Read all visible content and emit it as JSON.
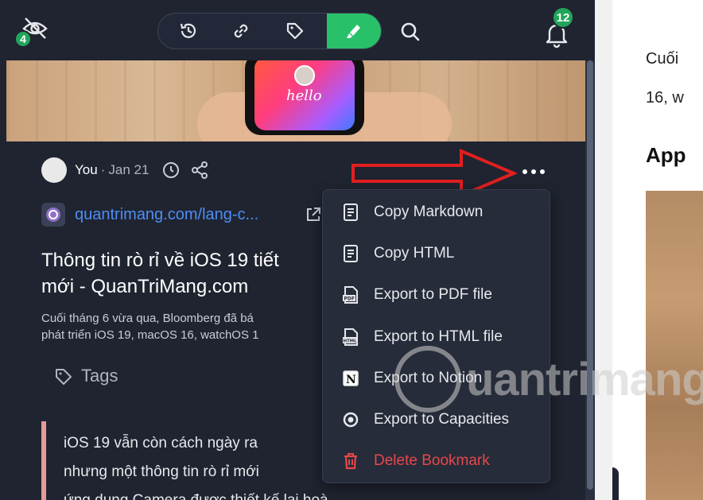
{
  "toolbar": {
    "hidden_count": "4",
    "notifications_count": "12",
    "icons": [
      "eye-off-icon",
      "history-icon",
      "link-icon",
      "tag-icon",
      "highlighter-icon",
      "search-icon",
      "bell-icon"
    ],
    "active_color": "#29c06a"
  },
  "hero": {
    "image_text": "hello"
  },
  "bookmark": {
    "author": "You",
    "separator": "·",
    "date": "Jan 21",
    "url": "quantrimang.com/lang-c...",
    "title_line1": "Thông tin rò rỉ về iOS 19 tiết",
    "title_line2": "mới - QuanTriMang.com",
    "desc_line1": "Cuối tháng 6 vừa qua, Bloomberg đã bá",
    "desc_line2": "phát triển iOS 19, macOS 16, watchOS 1",
    "tags_label": "Tags",
    "quote_line1": "iOS 19 vẫn còn cách ngày ra",
    "quote_line2": "nhưng một thông tin rò rỉ mới",
    "quote_line3": "ứng dụng Camera được thiết kế lại hoàn toàn",
    "quote_border_color": "#e79a9a"
  },
  "menu": {
    "items": [
      {
        "label": "Copy Markdown",
        "icon": "document-icon"
      },
      {
        "label": "Copy HTML",
        "icon": "document-icon"
      },
      {
        "label": "Export to PDF file",
        "icon": "pdf-file-icon"
      },
      {
        "label": "Export to HTML file",
        "icon": "html-file-icon"
      },
      {
        "label": "Export to Notion",
        "icon": "notion-icon"
      },
      {
        "label": "Export to Capacities",
        "icon": "capacities-icon"
      },
      {
        "label": "Delete Bookmark",
        "icon": "trash-icon"
      }
    ],
    "danger_color": "#e5484d"
  },
  "right_page": {
    "line1": "Cuối",
    "line2": "16, w",
    "heading": "App"
  },
  "watermark": {
    "text": "uantrimang"
  }
}
